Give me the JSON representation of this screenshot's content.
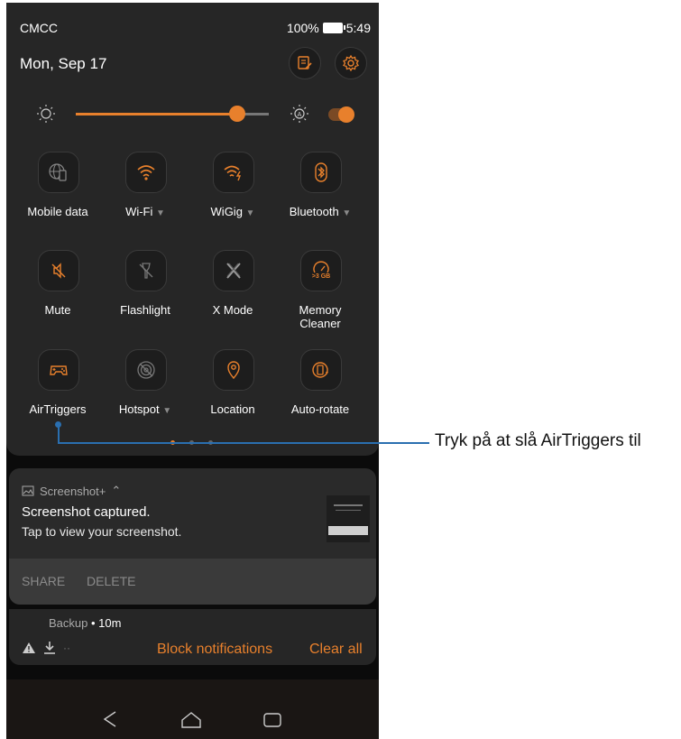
{
  "status": {
    "carrier": "CMCC",
    "battery": "100%",
    "time": "5:49"
  },
  "header": {
    "date": "Mon, Sep 17"
  },
  "brightness": {
    "level": 0.84,
    "auto": true
  },
  "tiles": [
    {
      "label": "Mobile data",
      "caret": "",
      "icon": "globe-phone-icon",
      "active": false
    },
    {
      "label": "Wi-Fi",
      "caret": "▼",
      "icon": "wifi-icon",
      "active": true
    },
    {
      "label": "WiGig",
      "caret": "▼",
      "icon": "wigig-icon",
      "active": true
    },
    {
      "label": "Bluetooth",
      "caret": "▼",
      "icon": "bluetooth-icon",
      "active": true
    },
    {
      "label": "Mute",
      "caret": "",
      "icon": "mute-icon",
      "active": true
    },
    {
      "label": "Flashlight",
      "caret": "",
      "icon": "flashlight-icon",
      "active": false
    },
    {
      "label": "X Mode",
      "caret": "",
      "icon": "x-mode-icon",
      "active": false
    },
    {
      "label": "Memory\nCleaner",
      "caret": "",
      "icon": "memory-cleaner-icon",
      "active": true
    },
    {
      "label": "AirTriggers",
      "caret": "",
      "icon": "airtriggers-icon",
      "active": true
    },
    {
      "label": "Hotspot",
      "caret": "▼",
      "icon": "hotspot-icon",
      "active": false
    },
    {
      "label": "Location",
      "caret": "",
      "icon": "location-icon",
      "active": true
    },
    {
      "label": "Auto-rotate",
      "caret": "",
      "icon": "auto-rotate-icon",
      "active": true
    }
  ],
  "memory_badge": ">3 GB",
  "notification": {
    "app": "Screenshot+",
    "title": "Screenshot captured.",
    "text": "Tap to view your screenshot.",
    "share": "SHARE",
    "delete": "DELETE"
  },
  "notification2": {
    "app": "Backup",
    "time": "10m",
    "block": "Block notifications",
    "clear": "Clear all"
  },
  "callout": "Tryk på at slå AirTriggers til",
  "colors": {
    "accent": "#e8802c",
    "callout": "#2a6fb0"
  }
}
